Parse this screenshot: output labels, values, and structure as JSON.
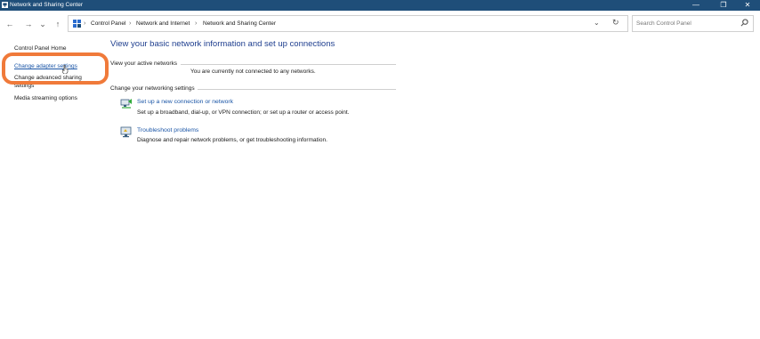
{
  "window": {
    "title": "Network and Sharing Center"
  },
  "titlebar_buttons": {
    "minimize": "—",
    "restore": "❐",
    "close": "✕"
  },
  "nav": {
    "back": "←",
    "forward": "→",
    "recent": "⌄",
    "up": "↑"
  },
  "breadcrumb": {
    "items": [
      "Control Panel",
      "Network and Internet",
      "Network and Sharing Center"
    ],
    "separator": "›",
    "dropdown": "⌄",
    "refresh": "↻"
  },
  "search": {
    "placeholder": "Search Control Panel"
  },
  "sidebar": {
    "items": [
      {
        "label": "Control Panel Home"
      },
      {
        "label": "Change adapter settings"
      },
      {
        "label": "Change advanced sharing"
      },
      {
        "label": "settings"
      },
      {
        "label": "Media streaming options"
      }
    ]
  },
  "main": {
    "heading": "View your basic network information and set up connections",
    "active_networks": {
      "label": "View your active networks",
      "status": "You are currently not connected to any networks."
    },
    "networking_settings": {
      "label": "Change your networking settings",
      "tasks": [
        {
          "link": "Set up a new connection or network",
          "desc": "Set up a broadband, dial-up, or VPN connection; or set up a router or access point.",
          "icon": "network-setup-icon"
        },
        {
          "link": "Troubleshoot problems",
          "desc": "Diagnose and repair network problems, or get troubleshooting information.",
          "icon": "troubleshoot-icon"
        }
      ]
    }
  },
  "colors": {
    "titlebar": "#1f4e79",
    "link": "#1a55a6",
    "heading": "#1f3f8f",
    "highlight": "#f07a3a"
  }
}
